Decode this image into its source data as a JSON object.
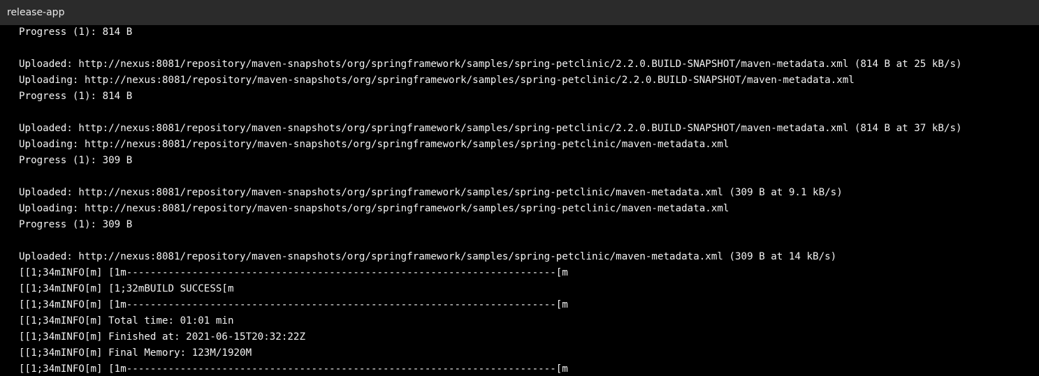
{
  "window": {
    "title": "release-app"
  },
  "console": {
    "lines": [
      "Progress (1): 814 B",
      "",
      "Uploaded: http://nexus:8081/repository/maven-snapshots/org/springframework/samples/spring-petclinic/2.2.0.BUILD-SNAPSHOT/maven-metadata.xml (814 B at 25 kB/s)",
      "Uploading: http://nexus:8081/repository/maven-snapshots/org/springframework/samples/spring-petclinic/2.2.0.BUILD-SNAPSHOT/maven-metadata.xml",
      "Progress (1): 814 B",
      "",
      "Uploaded: http://nexus:8081/repository/maven-snapshots/org/springframework/samples/spring-petclinic/2.2.0.BUILD-SNAPSHOT/maven-metadata.xml (814 B at 37 kB/s)",
      "Uploading: http://nexus:8081/repository/maven-snapshots/org/springframework/samples/spring-petclinic/maven-metadata.xml",
      "Progress (1): 309 B",
      "",
      "Uploaded: http://nexus:8081/repository/maven-snapshots/org/springframework/samples/spring-petclinic/maven-metadata.xml (309 B at 9.1 kB/s)",
      "Uploading: http://nexus:8081/repository/maven-snapshots/org/springframework/samples/spring-petclinic/maven-metadata.xml",
      "Progress (1): 309 B",
      "",
      "Uploaded: http://nexus:8081/repository/maven-snapshots/org/springframework/samples/spring-petclinic/maven-metadata.xml (309 B at 14 kB/s)",
      "[[1;34mINFO[m] [1m------------------------------------------------------------------------[m",
      "[[1;34mINFO[m] [1;32mBUILD SUCCESS[m",
      "[[1;34mINFO[m] [1m------------------------------------------------------------------------[m",
      "[[1;34mINFO[m] Total time: 01:01 min",
      "[[1;34mINFO[m] Finished at: 2021-06-15T20:32:22Z",
      "[[1;34mINFO[m] Final Memory: 123M/1920M",
      "[[1;34mINFO[m] [1m------------------------------------------------------------------------[m"
    ]
  }
}
